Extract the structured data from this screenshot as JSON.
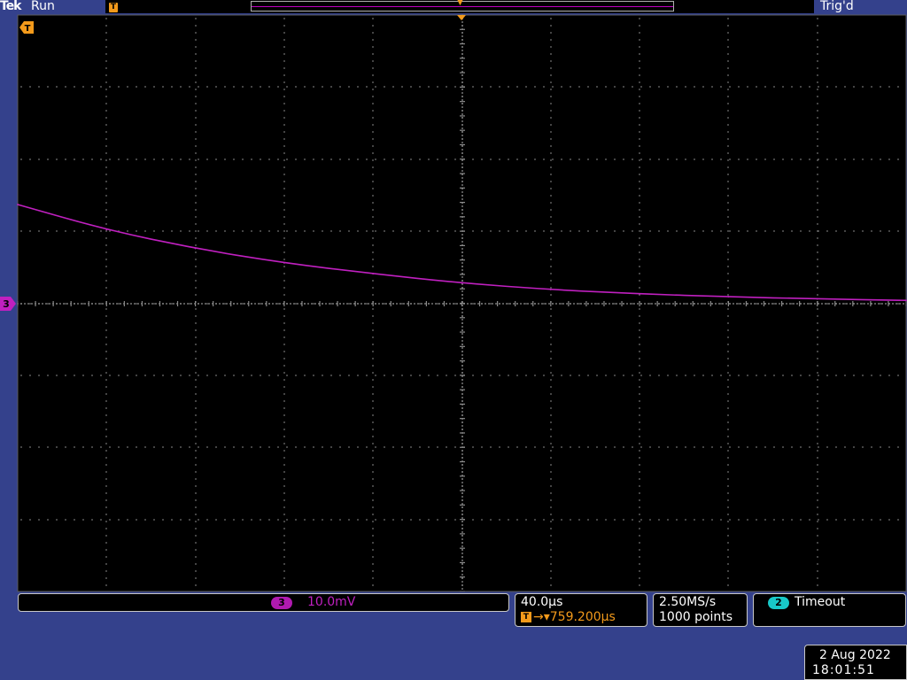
{
  "status_bar": {
    "brand": "Tek",
    "run_state": "Run",
    "trigger_state": "Trig'd",
    "record_trigger_marker": "T"
  },
  "screen": {
    "trigger_marker": "T",
    "channel_marker": "3"
  },
  "channel3": {
    "badge": "3",
    "scale": "10.0mV",
    "color": "#c020c0"
  },
  "horizontal": {
    "scale": "40.0µs",
    "trigger_icon": "T",
    "delay": "→▾759.200µs"
  },
  "acquisition": {
    "sample_rate": "2.50MS/s",
    "record_length": "1000 points"
  },
  "trigger": {
    "source_badge": "2",
    "mode": "Timeout",
    "color": "#18c8c8"
  },
  "timestamp": {
    "date": "2 Aug 2022",
    "time": "18:01:51"
  },
  "chart_data": {
    "type": "line",
    "grid": true,
    "xlabel": "",
    "ylabel": "",
    "xlim": [
      -5,
      5
    ],
    "ylim": [
      -4,
      4
    ],
    "series": [
      {
        "x": [
          -5,
          -4,
          -3,
          -2,
          -1,
          0,
          1,
          2,
          3,
          4,
          5
        ],
        "y": [
          1.37,
          1.02,
          0.76,
          0.56,
          0.41,
          0.28,
          0.19,
          0.13,
          0.09,
          0.06,
          0.04
        ],
        "color": "#c020c0"
      }
    ]
  }
}
